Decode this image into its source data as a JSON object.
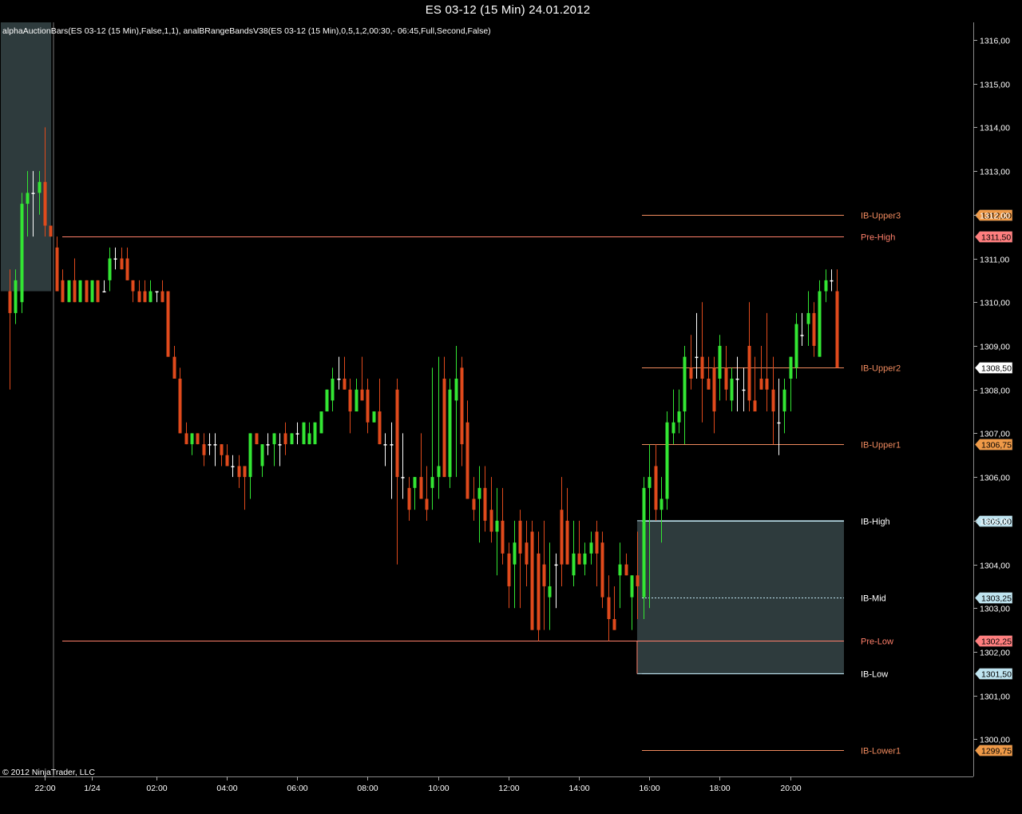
{
  "window": {
    "title": "ES 03-12 (15 Min)  24.01.2012",
    "indicator_text": "alphaAuctionBars(ES 03-12 (15 Min),False,1,1), analBRangeBandsV38(ES 03-12 (15 Min),0,5,1,2,00:30,- 06:45,Full,Second,False)",
    "copyright": "© 2012 NinjaTrader, LLC"
  },
  "colors": {
    "up": "#33e633",
    "down": "#e04a1c",
    "neutral": "#ffffff",
    "up_light": "#ffd2b0",
    "ib_box": "#2e3b3d",
    "level_orange": "#ef8a5e",
    "level_red": "#ff7f6a",
    "level_blue": "#bfe4f0"
  },
  "chart_data": {
    "type": "candlestick",
    "title": "ES 03-12 (15 Min)  24.01.2012",
    "ylim": [
      1299.15,
      1316.4
    ],
    "y_ticks": [
      "1300,00",
      "1301,00",
      "1302,00",
      "1303,00",
      "1304,00",
      "1305,00",
      "1306,00",
      "1307,00",
      "1308,00",
      "1309,00",
      "1310,00",
      "1311,00",
      "1312,00",
      "1313,00",
      "1314,00",
      "1315,00",
      "1316,00"
    ],
    "x_ticks": [
      "22:00",
      "1/24",
      "02:00",
      "04:00",
      "06:00",
      "08:00",
      "10:00",
      "12:00",
      "14:00",
      "16:00",
      "18:00",
      "20:00"
    ],
    "candles": [
      {
        "o": 1310.25,
        "h": 1310.75,
        "l": 1308.0,
        "c": 1309.75
      },
      {
        "o": 1309.75,
        "h": 1310.75,
        "l": 1309.5,
        "c": 1310.5
      },
      {
        "o": 1310.0,
        "h": 1312.5,
        "l": 1309.75,
        "c": 1312.25
      },
      {
        "o": 1312.25,
        "h": 1313.0,
        "l": 1311.5,
        "c": 1312.5
      },
      {
        "o": 1312.5,
        "h": 1313.0,
        "l": 1311.5,
        "c": 1312.5
      },
      {
        "o": 1312.5,
        "h": 1313.0,
        "l": 1312.0,
        "c": 1312.75
      },
      {
        "o": 1312.75,
        "h": 1314.0,
        "l": 1311.5,
        "c": 1311.75
      },
      {
        "o": 1311.75,
        "h": 1311.75,
        "l": 1311.5,
        "c": 1311.5
      },
      {
        "o": 1311.25,
        "h": 1311.5,
        "l": 1310.25,
        "c": 1310.25
      },
      {
        "o": 1310.5,
        "h": 1310.75,
        "l": 1310.0,
        "c": 1310.0
      },
      {
        "o": 1310.0,
        "h": 1310.5,
        "l": 1310.0,
        "c": 1310.5
      },
      {
        "o": 1310.5,
        "h": 1311.0,
        "l": 1310.0,
        "c": 1310.0
      },
      {
        "o": 1310.0,
        "h": 1310.5,
        "l": 1310.0,
        "c": 1310.5
      },
      {
        "o": 1310.5,
        "h": 1310.5,
        "l": 1310.0,
        "c": 1310.0
      },
      {
        "o": 1310.0,
        "h": 1310.5,
        "l": 1310.0,
        "c": 1310.5
      },
      {
        "o": 1310.5,
        "h": 1310.5,
        "l": 1310.0,
        "c": 1310.0
      },
      {
        "o": 1310.25,
        "h": 1310.5,
        "l": 1310.25,
        "c": 1310.25
      },
      {
        "o": 1310.5,
        "h": 1311.25,
        "l": 1310.25,
        "c": 1311.0
      },
      {
        "o": 1311.0,
        "h": 1311.25,
        "l": 1310.75,
        "c": 1311.0
      },
      {
        "o": 1311.0,
        "h": 1311.25,
        "l": 1310.75,
        "c": 1310.75
      },
      {
        "o": 1311.0,
        "h": 1311.25,
        "l": 1310.5,
        "c": 1310.5
      },
      {
        "o": 1310.5,
        "h": 1310.5,
        "l": 1310.0,
        "c": 1310.25
      },
      {
        "o": 1310.25,
        "h": 1310.5,
        "l": 1310.0,
        "c": 1310.0
      },
      {
        "o": 1310.25,
        "h": 1310.5,
        "l": 1310.0,
        "c": 1310.0
      },
      {
        "o": 1310.0,
        "h": 1310.5,
        "l": 1310.0,
        "c": 1310.25
      },
      {
        "o": 1310.25,
        "h": 1310.25,
        "l": 1310.0,
        "c": 1310.25
      },
      {
        "o": 1310.25,
        "h": 1310.5,
        "l": 1310.0,
        "c": 1310.0
      },
      {
        "o": 1310.25,
        "h": 1310.25,
        "l": 1308.75,
        "c": 1308.75
      },
      {
        "o": 1308.75,
        "h": 1309.0,
        "l": 1308.25,
        "c": 1308.25
      },
      {
        "o": 1308.25,
        "h": 1308.5,
        "l": 1307.0,
        "c": 1307.0
      },
      {
        "o": 1307.0,
        "h": 1307.25,
        "l": 1306.75,
        "c": 1306.75
      },
      {
        "o": 1306.75,
        "h": 1307.0,
        "l": 1306.5,
        "c": 1307.0
      },
      {
        "o": 1307.0,
        "h": 1307.0,
        "l": 1306.75,
        "c": 1306.75
      },
      {
        "o": 1306.75,
        "h": 1307.0,
        "l": 1306.25,
        "c": 1306.5
      },
      {
        "o": 1306.75,
        "h": 1307.0,
        "l": 1306.5,
        "c": 1306.75
      },
      {
        "o": 1306.75,
        "h": 1307.0,
        "l": 1306.25,
        "c": 1306.75
      },
      {
        "o": 1306.75,
        "h": 1306.75,
        "l": 1306.25,
        "c": 1306.5
      },
      {
        "o": 1306.5,
        "h": 1306.75,
        "l": 1306.25,
        "c": 1306.25
      },
      {
        "o": 1306.25,
        "h": 1306.5,
        "l": 1306.0,
        "c": 1306.25
      },
      {
        "o": 1306.25,
        "h": 1306.5,
        "l": 1305.75,
        "c": 1306.0
      },
      {
        "o": 1306.25,
        "h": 1306.25,
        "l": 1305.25,
        "c": 1306.0
      },
      {
        "o": 1306.0,
        "h": 1307.0,
        "l": 1305.5,
        "c": 1307.0
      },
      {
        "o": 1307.0,
        "h": 1307.0,
        "l": 1306.75,
        "c": 1306.75
      },
      {
        "o": 1306.25,
        "h": 1306.75,
        "l": 1306.0,
        "c": 1306.75
      },
      {
        "o": 1306.75,
        "h": 1307.0,
        "l": 1306.5,
        "c": 1306.75
      },
      {
        "o": 1306.75,
        "h": 1307.0,
        "l": 1306.25,
        "c": 1307.0
      },
      {
        "o": 1306.75,
        "h": 1307.0,
        "l": 1306.25,
        "c": 1306.75
      },
      {
        "o": 1307.0,
        "h": 1307.25,
        "l": 1306.5,
        "c": 1306.75
      },
      {
        "o": 1306.75,
        "h": 1307.0,
        "l": 1306.75,
        "c": 1307.0
      },
      {
        "o": 1307.0,
        "h": 1307.25,
        "l": 1306.75,
        "c": 1307.0
      },
      {
        "o": 1306.75,
        "h": 1307.25,
        "l": 1306.75,
        "c": 1307.25
      },
      {
        "o": 1306.75,
        "h": 1307.25,
        "l": 1306.75,
        "c": 1307.0
      },
      {
        "o": 1306.75,
        "h": 1307.25,
        "l": 1306.75,
        "c": 1307.25
      },
      {
        "o": 1307.0,
        "h": 1307.5,
        "l": 1307.0,
        "c": 1307.5
      },
      {
        "o": 1307.5,
        "h": 1308.0,
        "l": 1307.5,
        "c": 1308.0
      },
      {
        "o": 1307.75,
        "h": 1308.5,
        "l": 1307.5,
        "c": 1308.25
      },
      {
        "o": 1308.25,
        "h": 1308.75,
        "l": 1308.0,
        "c": 1308.25
      },
      {
        "o": 1308.25,
        "h": 1308.75,
        "l": 1308.0,
        "c": 1308.0
      },
      {
        "o": 1308.0,
        "h": 1308.25,
        "l": 1307.0,
        "c": 1307.5
      },
      {
        "o": 1307.5,
        "h": 1308.25,
        "l": 1307.5,
        "c": 1308.0
      },
      {
        "o": 1308.0,
        "h": 1308.75,
        "l": 1307.75,
        "c": 1307.75
      },
      {
        "o": 1308.0,
        "h": 1308.25,
        "l": 1307.0,
        "c": 1307.25
      },
      {
        "o": 1307.25,
        "h": 1307.5,
        "l": 1307.25,
        "c": 1307.5
      },
      {
        "o": 1307.5,
        "h": 1308.25,
        "l": 1306.75,
        "c": 1306.75
      },
      {
        "o": 1306.75,
        "h": 1307.0,
        "l": 1306.25,
        "c": 1306.75
      },
      {
        "o": 1306.75,
        "h": 1307.25,
        "l": 1305.5,
        "c": 1306.75
      },
      {
        "o": 1308.0,
        "h": 1308.25,
        "l": 1304.0,
        "c": 1306.0
      },
      {
        "o": 1306.0,
        "h": 1307.0,
        "l": 1305.5,
        "c": 1306.0
      },
      {
        "o": 1305.75,
        "h": 1306.0,
        "l": 1305.0,
        "c": 1305.25
      },
      {
        "o": 1305.75,
        "h": 1306.0,
        "l": 1305.25,
        "c": 1306.0
      },
      {
        "o": 1306.0,
        "h": 1307.0,
        "l": 1305.5,
        "c": 1305.5
      },
      {
        "o": 1305.5,
        "h": 1306.25,
        "l": 1305.0,
        "c": 1305.25
      },
      {
        "o": 1305.75,
        "h": 1308.5,
        "l": 1305.25,
        "c": 1306.0
      },
      {
        "o": 1306.0,
        "h": 1308.75,
        "l": 1305.5,
        "c": 1306.25
      },
      {
        "o": 1308.25,
        "h": 1308.75,
        "l": 1306.0,
        "c": 1306.0
      },
      {
        "o": 1306.0,
        "h": 1308.25,
        "l": 1305.75,
        "c": 1308.0
      },
      {
        "o": 1307.75,
        "h": 1309.0,
        "l": 1306.0,
        "c": 1308.25
      },
      {
        "o": 1308.5,
        "h": 1308.75,
        "l": 1306.25,
        "c": 1306.75
      },
      {
        "o": 1307.25,
        "h": 1307.75,
        "l": 1305.5,
        "c": 1305.5
      },
      {
        "o": 1305.5,
        "h": 1306.0,
        "l": 1305.0,
        "c": 1305.25
      },
      {
        "o": 1305.5,
        "h": 1306.25,
        "l": 1304.5,
        "c": 1305.75
      },
      {
        "o": 1305.75,
        "h": 1306.25,
        "l": 1304.75,
        "c": 1305.0
      },
      {
        "o": 1305.25,
        "h": 1306.0,
        "l": 1304.5,
        "c": 1304.75
      },
      {
        "o": 1304.75,
        "h": 1305.75,
        "l": 1303.75,
        "c": 1305.0
      },
      {
        "o": 1305.0,
        "h": 1305.75,
        "l": 1304.0,
        "c": 1304.25
      },
      {
        "o": 1304.25,
        "h": 1304.5,
        "l": 1303.0,
        "c": 1303.5
      },
      {
        "o": 1304.0,
        "h": 1305.0,
        "l": 1303.0,
        "c": 1304.5
      },
      {
        "o": 1305.0,
        "h": 1305.25,
        "l": 1303.0,
        "c": 1304.25
      },
      {
        "o": 1304.5,
        "h": 1305.0,
        "l": 1303.5,
        "c": 1304.0
      },
      {
        "o": 1304.75,
        "h": 1305.0,
        "l": 1302.5,
        "c": 1302.5
      },
      {
        "o": 1304.25,
        "h": 1304.75,
        "l": 1302.25,
        "c": 1302.5
      },
      {
        "o": 1304.0,
        "h": 1305.0,
        "l": 1302.5,
        "c": 1303.5
      },
      {
        "o": 1303.25,
        "h": 1304.5,
        "l": 1302.5,
        "c": 1303.5
      },
      {
        "o": 1304.0,
        "h": 1304.25,
        "l": 1303.0,
        "c": 1304.0
      },
      {
        "o": 1305.25,
        "h": 1306.0,
        "l": 1303.5,
        "c": 1304.0
      },
      {
        "o": 1305.0,
        "h": 1305.75,
        "l": 1304.0,
        "c": 1304.0
      },
      {
        "o": 1303.75,
        "h": 1305.0,
        "l": 1303.5,
        "c": 1304.25
      },
      {
        "o": 1304.25,
        "h": 1305.0,
        "l": 1304.0,
        "c": 1304.0
      },
      {
        "o": 1304.0,
        "h": 1304.5,
        "l": 1303.75,
        "c": 1304.25
      },
      {
        "o": 1304.25,
        "h": 1304.75,
        "l": 1304.0,
        "c": 1304.5
      },
      {
        "o": 1304.75,
        "h": 1305.0,
        "l": 1303.5,
        "c": 1304.25
      },
      {
        "o": 1304.5,
        "h": 1304.75,
        "l": 1303.0,
        "c": 1303.25
      },
      {
        "o": 1303.25,
        "h": 1303.75,
        "l": 1302.25,
        "c": 1302.75
      },
      {
        "o": 1302.75,
        "h": 1303.5,
        "l": 1302.5,
        "c": 1302.5
      },
      {
        "o": 1303.75,
        "h": 1304.5,
        "l": 1303.0,
        "c": 1304.0
      },
      {
        "o": 1304.0,
        "h": 1304.25,
        "l": 1303.75,
        "c": 1303.75
      },
      {
        "o": 1303.25,
        "h": 1303.75,
        "l": 1302.5,
        "c": 1303.75
      },
      {
        "o": 1303.75,
        "h": 1304.75,
        "l": 1302.75,
        "c": 1303.5
      },
      {
        "o": 1303.25,
        "h": 1306.0,
        "l": 1302.75,
        "c": 1305.75
      },
      {
        "o": 1305.75,
        "h": 1306.75,
        "l": 1303.0,
        "c": 1306.0
      },
      {
        "o": 1306.25,
        "h": 1306.75,
        "l": 1305.0,
        "c": 1305.25
      },
      {
        "o": 1305.25,
        "h": 1306.0,
        "l": 1304.5,
        "c": 1305.5
      },
      {
        "o": 1305.5,
        "h": 1307.5,
        "l": 1305.25,
        "c": 1307.25
      },
      {
        "o": 1307.0,
        "h": 1308.0,
        "l": 1306.75,
        "c": 1307.25
      },
      {
        "o": 1307.25,
        "h": 1308.0,
        "l": 1307.0,
        "c": 1307.5
      },
      {
        "o": 1307.5,
        "h": 1309.0,
        "l": 1306.75,
        "c": 1308.75
      },
      {
        "o": 1308.5,
        "h": 1309.25,
        "l": 1308.0,
        "c": 1308.25
      },
      {
        "o": 1308.75,
        "h": 1309.75,
        "l": 1308.25,
        "c": 1308.75
      },
      {
        "o": 1308.75,
        "h": 1310.0,
        "l": 1307.25,
        "c": 1308.25
      },
      {
        "o": 1308.25,
        "h": 1308.75,
        "l": 1308.0,
        "c": 1308.0
      },
      {
        "o": 1308.5,
        "h": 1308.75,
        "l": 1307.0,
        "c": 1307.5
      },
      {
        "o": 1308.25,
        "h": 1309.25,
        "l": 1307.75,
        "c": 1309.0
      },
      {
        "o": 1308.5,
        "h": 1309.0,
        "l": 1307.75,
        "c": 1308.0
      },
      {
        "o": 1307.75,
        "h": 1308.5,
        "l": 1307.5,
        "c": 1308.25
      },
      {
        "o": 1308.25,
        "h": 1308.75,
        "l": 1307.5,
        "c": 1308.25
      },
      {
        "o": 1308.0,
        "h": 1308.5,
        "l": 1307.5,
        "c": 1308.0
      },
      {
        "o": 1309.0,
        "h": 1310.0,
        "l": 1307.5,
        "c": 1307.75
      },
      {
        "o": 1307.75,
        "h": 1308.75,
        "l": 1307.5,
        "c": 1307.5
      },
      {
        "o": 1308.25,
        "h": 1309.0,
        "l": 1308.0,
        "c": 1308.0
      },
      {
        "o": 1308.25,
        "h": 1309.75,
        "l": 1307.5,
        "c": 1308.0
      },
      {
        "o": 1308.0,
        "h": 1308.75,
        "l": 1306.75,
        "c": 1307.5
      },
      {
        "o": 1307.25,
        "h": 1308.25,
        "l": 1306.5,
        "c": 1307.25
      },
      {
        "o": 1307.5,
        "h": 1308.25,
        "l": 1307.0,
        "c": 1308.0
      },
      {
        "o": 1308.25,
        "h": 1308.75,
        "l": 1307.5,
        "c": 1308.75
      },
      {
        "o": 1308.5,
        "h": 1309.75,
        "l": 1308.25,
        "c": 1309.5
      },
      {
        "o": 1309.25,
        "h": 1309.75,
        "l": 1309.0,
        "c": 1309.25
      },
      {
        "o": 1309.5,
        "h": 1310.25,
        "l": 1309.0,
        "c": 1309.75
      },
      {
        "o": 1309.75,
        "h": 1310.0,
        "l": 1308.75,
        "c": 1309.0
      },
      {
        "o": 1308.75,
        "h": 1310.5,
        "l": 1308.75,
        "c": 1310.25
      },
      {
        "o": 1310.25,
        "h": 1310.75,
        "l": 1310.0,
        "c": 1310.5
      },
      {
        "o": 1310.5,
        "h": 1310.75,
        "l": 1310.25,
        "c": 1310.5
      },
      {
        "o": 1310.25,
        "h": 1310.75,
        "l": 1308.5,
        "c": 1308.5
      }
    ],
    "sessions": {
      "prior_ib_box": {
        "x_end_index": 6,
        "high": 1316.4,
        "low": 1310.25
      },
      "ib_box": {
        "start_index": 107,
        "high": 1305.0,
        "low": 1301.5
      }
    },
    "levels": [
      {
        "name": "IB-Upper3",
        "value": 1312.0,
        "tag": "1312,00",
        "color": "level_orange",
        "start_index": 107,
        "tag_bg": "#ef9a48"
      },
      {
        "name": "Pre-High",
        "value": 1311.5,
        "tag": "1311,50",
        "color": "level_red",
        "start_index": 8,
        "tag_bg": "#ff7f7f"
      },
      {
        "name": "IB-Upper2",
        "value": 1308.5,
        "tag": "1308,50",
        "color": "level_orange",
        "start_index": 107,
        "tag_bg": "#ffffff"
      },
      {
        "name": "IB-Upper1",
        "value": 1306.75,
        "tag": "1306,75",
        "color": "level_orange",
        "start_index": 107,
        "tag_bg": "#ef9a48"
      },
      {
        "name": "IB-High",
        "value": 1305.0,
        "tag": "1305,00",
        "color": "level_blue",
        "start_index": 107,
        "tag_bg": "#bfe4f0"
      },
      {
        "name": "IB-Mid",
        "value": 1303.25,
        "tag": "1303,25",
        "color": "level_blue",
        "start_index": 107,
        "tag_bg": "#bfe4f0"
      },
      {
        "name": "Pre-Low",
        "value": 1302.25,
        "tag": "1302,25",
        "color": "level_red",
        "start_index": 8,
        "tag_bg": "#ff7f7f"
      },
      {
        "name": "IB-Low",
        "value": 1301.5,
        "tag": "1301,50",
        "color": "level_blue",
        "start_index": 107,
        "tag_bg": "#bfe4f0"
      },
      {
        "name": "IB-Lower1",
        "value": 1299.75,
        "tag": "1299,75",
        "color": "level_orange",
        "start_index": 107,
        "tag_bg": "#ef9a48"
      }
    ]
  }
}
